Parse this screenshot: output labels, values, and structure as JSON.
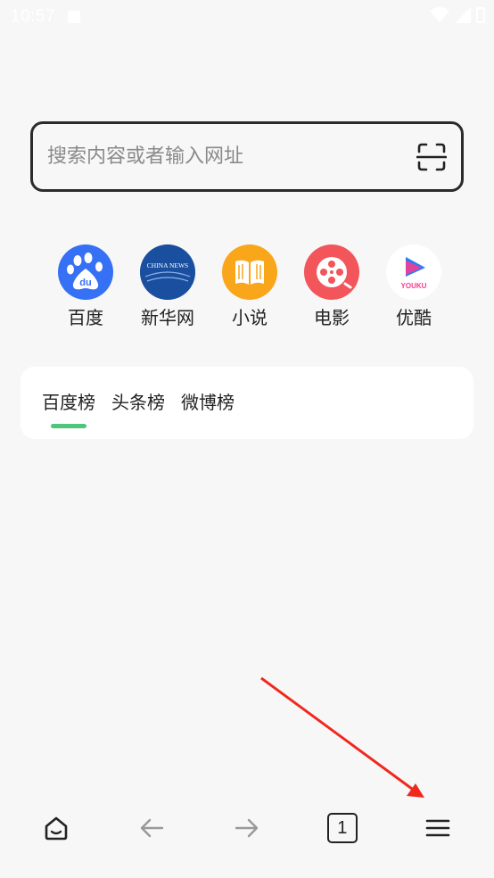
{
  "status_bar": {
    "time": "10:57"
  },
  "search": {
    "placeholder": "搜索内容或者输入网址",
    "value": ""
  },
  "quick_links": [
    {
      "label": "百度",
      "icon": "baidu-paw-icon",
      "color": "#3670f4",
      "logo_text": "du"
    },
    {
      "label": "新华网",
      "icon": "xinhua-globe-icon",
      "color": "#1a4fa0",
      "logo_text": "CHINA NEWS"
    },
    {
      "label": "小说",
      "icon": "book-icon",
      "color": "#f9a61a"
    },
    {
      "label": "电影",
      "icon": "film-reel-icon",
      "color": "#f2555a"
    },
    {
      "label": "优酷",
      "icon": "youku-play-icon",
      "color": "#ffffff",
      "logo_text": "YOUKU"
    }
  ],
  "hot_tabs": [
    {
      "label": "百度榜",
      "active": true
    },
    {
      "label": "头条榜",
      "active": false
    },
    {
      "label": "微博榜",
      "active": false
    }
  ],
  "bottom_nav": {
    "items": [
      "home-icon",
      "back-arrow-icon",
      "forward-arrow-icon",
      "tabs-icon",
      "menu-icon"
    ],
    "tab_count": "1"
  },
  "colors": {
    "accent_underline": "#4ec57a",
    "annotation_arrow": "#f0281e",
    "background": "#f7f7f7"
  }
}
